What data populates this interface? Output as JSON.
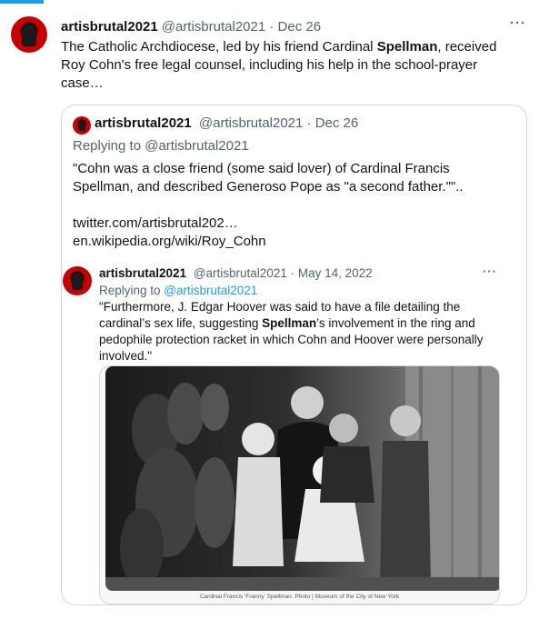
{
  "tweet": {
    "name": "artisbrutal2021",
    "handle_date": "@artisbrutal2021 · Dec 26",
    "more": "···",
    "text_parts": {
      "a": "The Catholic Archdiocese, led by his friend Cardinal ",
      "b": "Spellman",
      "c": ", received Roy Cohn's free legal counsel, including his help in the school-prayer case…"
    }
  },
  "quote": {
    "name": "artisbrutal2021",
    "handle_date": "@artisbrutal2021 · Dec 26",
    "replying": "Replying to @artisbrutal2021",
    "text": "\"Cohn was a close friend (some said lover) of Cardinal Francis Spellman, and described Generoso Pope as \"a second father.\"\"..",
    "link1": "twitter.com/artisbrutal202…",
    "link2": "en.wikipedia.org/wiki/Roy_Cohn"
  },
  "inner": {
    "name": "artisbrutal2021",
    "handle_date": "@artisbrutal2021 · May 14, 2022",
    "more": "···",
    "replying_prefix": "Replying to ",
    "replying_mention": "@artisbrutal2021",
    "text_parts": {
      "a": "\"Furthermore, J. Edgar Hoover was said to have a file detailing the cardinal’s sex life, suggesting ",
      "b": "Spellman",
      "c": "’s involvement in the ring and pedophile protection racket in which Cohn and Hoover were personally involved.\""
    },
    "caption": "Cardinal Francis ‘Franny’ Spellman. Photo | Museum of the City of New York"
  },
  "colors": {
    "accent": "#1d9bf0",
    "muted": "#536471",
    "text": "#0f1419",
    "border": "#cfd9de"
  },
  "icons": {
    "more": "more-horizontal-icon"
  }
}
